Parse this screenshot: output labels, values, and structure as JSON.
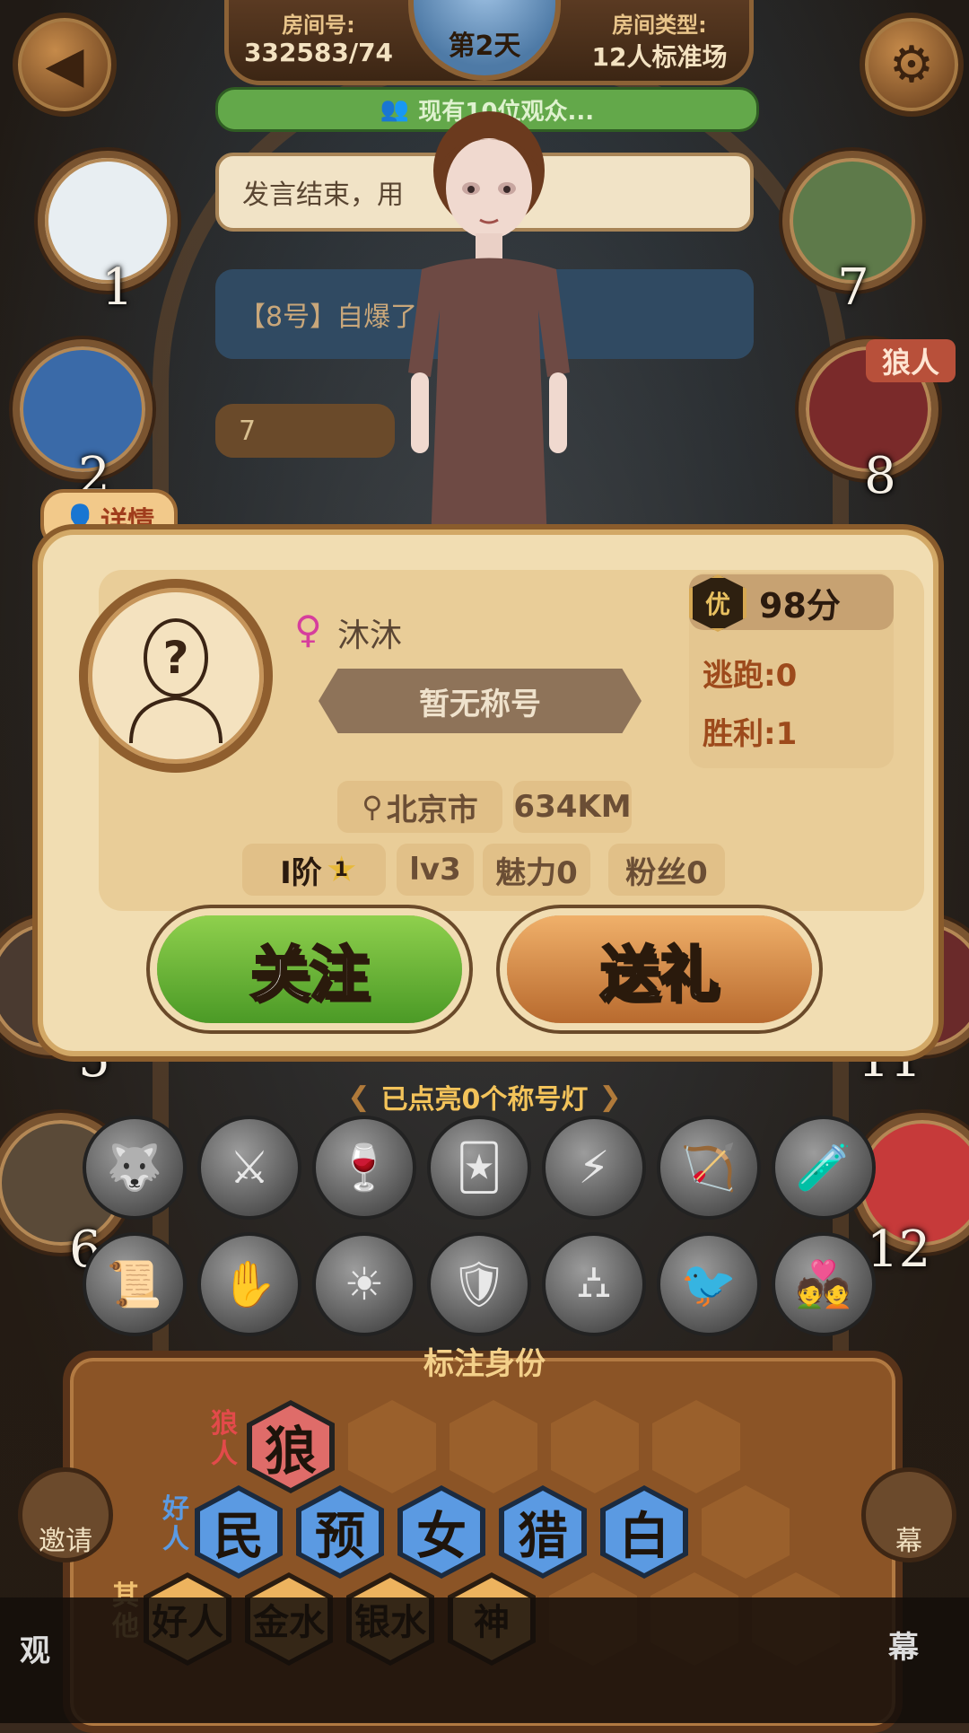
{
  "header": {
    "room_number_label": "房间号:",
    "room_number": "332583/74",
    "room_type_label": "房间类型:",
    "room_type": "12人标准场",
    "day": "第2天"
  },
  "chat": {
    "spectators": "现有10位观众...",
    "message_1": "发言结束，用",
    "message_2": "【8号】自爆了",
    "message_3": "7"
  },
  "seats": [
    {
      "number": "1",
      "color": "#e8eef2"
    },
    {
      "number": "2",
      "color": "#3a6aa8"
    },
    {
      "number": "5",
      "color": "#4a3a30"
    },
    {
      "number": "6",
      "color": "#5a4a38"
    },
    {
      "number": "7",
      "color": "#5e7a4a"
    },
    {
      "number": "8",
      "color": "#7a2a2a"
    },
    {
      "number": "11",
      "color": "#6a2a2a"
    },
    {
      "number": "12",
      "color": "#c63a3a"
    }
  ],
  "wolf_tag": "狼人",
  "detail_tag": "详情",
  "profile": {
    "gender_icon": "female-icon",
    "nickname": "沐沐",
    "title": "暂无称号",
    "score_badge": "优",
    "score": "98分",
    "escape": "逃跑:0",
    "wins": "胜利:1",
    "location": "北京市",
    "distance": "634KM",
    "rank": "I阶",
    "rank_star": "1",
    "level": "lv3",
    "charm": "魅力0",
    "fans": "粉丝0"
  },
  "buttons": {
    "follow": "关注",
    "gift": "送礼"
  },
  "title_lights": {
    "header": "已点亮0个称号灯",
    "icons": [
      "wolf-icon",
      "werewolf-icon",
      "potion-cup-icon",
      "mask-cards-icon",
      "lightning-icon",
      "hammer-bow-icon",
      "bottles-icon",
      "scroll-icon",
      "claw-hand-icon",
      "sun-badge-icon",
      "shield-sword-icon",
      "tombstone-icon",
      "raven-icon",
      "lovers-icon"
    ]
  },
  "identity": {
    "title": "标注身份",
    "row_wolf_label": "狼人",
    "row_good_label": "好人",
    "row_other_label": "其他",
    "wolf": [
      "狼"
    ],
    "good": [
      "民",
      "预",
      "女",
      "猎",
      "白"
    ],
    "other": [
      "好人",
      "金水",
      "银水",
      "神"
    ]
  },
  "side": {
    "invite": "邀请",
    "barrage": "幕",
    "barrage_2": "幕",
    "watch": "观"
  }
}
